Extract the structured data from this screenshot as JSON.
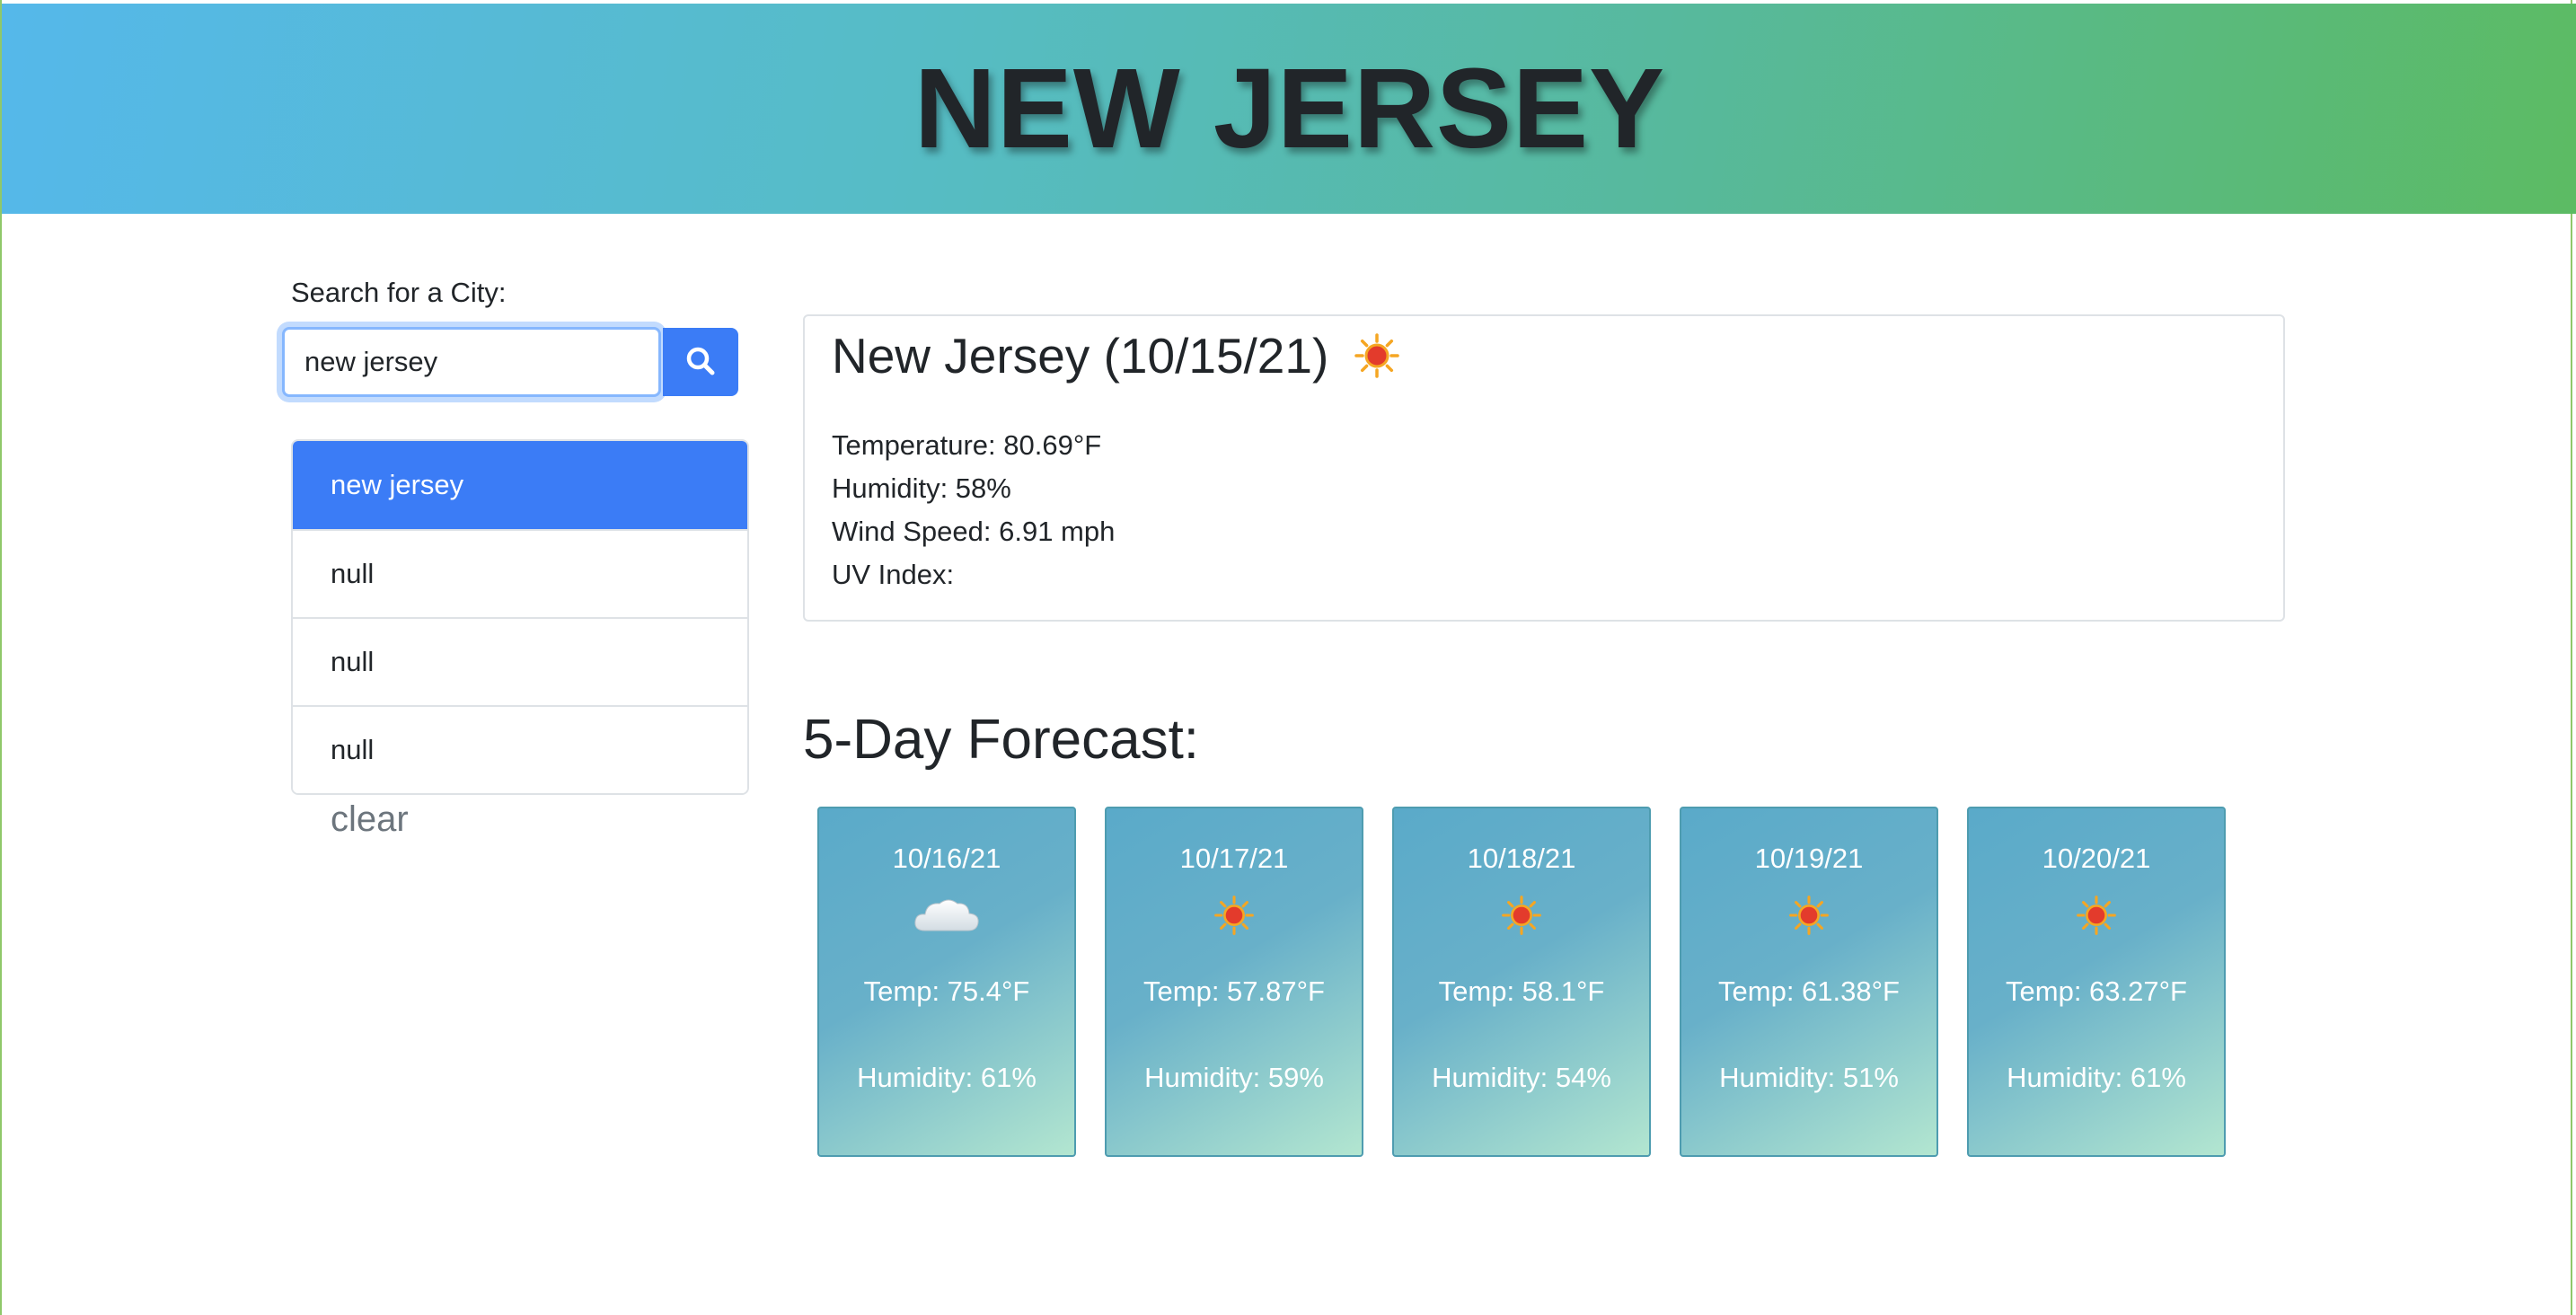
{
  "header": {
    "title": "NEW JERSEY"
  },
  "search": {
    "label": "Search for a City:",
    "value": "new jersey",
    "button_icon": "search-icon"
  },
  "history": {
    "items": [
      {
        "label": "new jersey",
        "active": true
      },
      {
        "label": "null",
        "active": false
      },
      {
        "label": "null",
        "active": false
      },
      {
        "label": "null",
        "active": false
      }
    ],
    "clear_label": "clear"
  },
  "current": {
    "title": "New Jersey (10/15/21)",
    "icon": "sun-icon",
    "temperature": "Temperature: 80.69°F",
    "humidity": "Humidity: 58%",
    "wind": "Wind Speed: 6.91 mph",
    "uv": "UV Index:"
  },
  "forecast": {
    "heading": "5-Day Forecast:",
    "days": [
      {
        "date": "10/16/21",
        "icon": "cloud-icon",
        "temp": "Temp: 75.4°F",
        "humidity": "Humidity: 61%"
      },
      {
        "date": "10/17/21",
        "icon": "sun-icon",
        "temp": "Temp: 57.87°F",
        "humidity": "Humidity: 59%"
      },
      {
        "date": "10/18/21",
        "icon": "sun-icon",
        "temp": "Temp: 58.1°F",
        "humidity": "Humidity: 54%"
      },
      {
        "date": "10/19/21",
        "icon": "sun-icon",
        "temp": "Temp: 61.38°F",
        "humidity": "Humidity: 51%"
      },
      {
        "date": "10/20/21",
        "icon": "sun-icon",
        "temp": "Temp: 63.27°F",
        "humidity": "Humidity: 61%"
      }
    ]
  },
  "colors": {
    "accent": "#3b7cf6",
    "header_start": "#55b8ea",
    "header_end": "#5cbb63",
    "card_start": "#5aaac9",
    "card_end": "#b3e6d0"
  }
}
